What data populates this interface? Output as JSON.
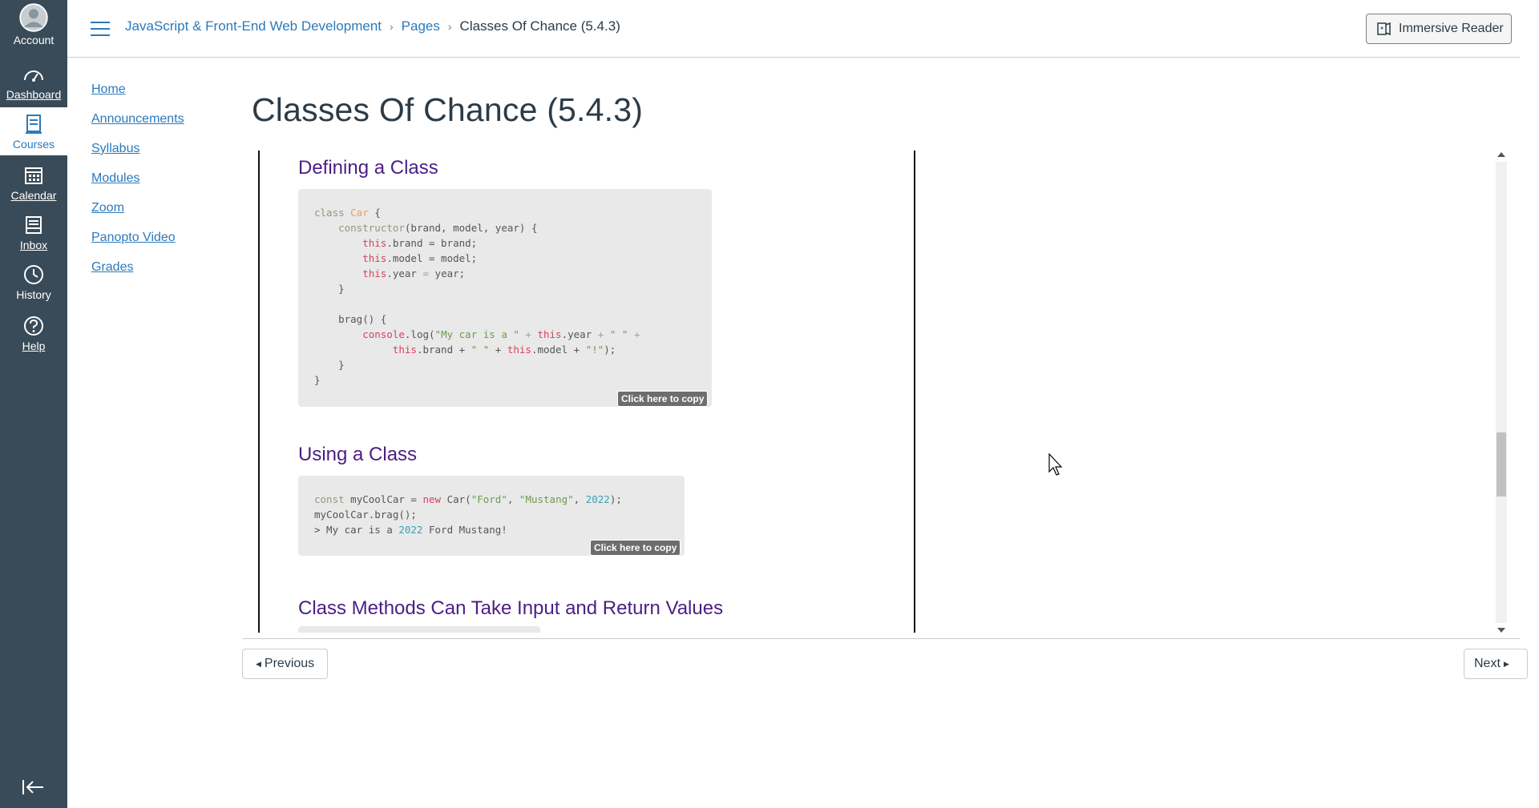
{
  "global_nav": {
    "account": "Account",
    "dashboard": "Dashboard",
    "courses": "Courses",
    "calendar": "Calendar",
    "inbox": "Inbox",
    "history": "History",
    "help": "Help"
  },
  "header": {
    "breadcrumb": [
      "JavaScript & Front-End Web Development",
      "Pages",
      "Classes Of Chance (5.4.3)"
    ],
    "immersive_reader": "Immersive Reader"
  },
  "course_nav": [
    "Home",
    "Announcements",
    "Syllabus",
    "Modules",
    "Zoom",
    "Panopto Video",
    "Grades"
  ],
  "page": {
    "title": "Classes Of Chance (5.4.3)",
    "sections": [
      {
        "heading": "Defining a Class"
      },
      {
        "heading": "Using a Class"
      },
      {
        "heading": "Class Methods Can Take Input and Return Values"
      }
    ],
    "copy_label": "Click here to copy",
    "code1": {
      "l1a": "class ",
      "l1b": "Car",
      "l1c": " {",
      "l2a": "    ",
      "l2b": "constructor",
      "l2c": "(brand, model, year) {",
      "l3a": "        ",
      "l3b": "this",
      "l3c": ".brand = brand;",
      "l4a": "        ",
      "l4b": "this",
      "l4c": ".model = model;",
      "l5a": "        ",
      "l5b": "this",
      "l5c": ".year ",
      "l5d": "=",
      "l5e": " year;",
      "l6": "    }",
      "l8": "    brag() {",
      "l9a": "        ",
      "l9b": "console",
      "l9c": ".log(",
      "l9d": "\"My car is a \"",
      "l9e": " + ",
      "l9f": "this",
      "l9g": ".year ",
      "l9h": "+",
      "l9i": " ",
      "l9j": "\" \"",
      "l9k": " +",
      "l10a": "             ",
      "l10b": "this",
      "l10c": ".brand + ",
      "l10d": "\" \"",
      "l10e": " + ",
      "l10f": "this",
      "l10g": ".model + ",
      "l10h": "\"!\"",
      "l10i": ");",
      "l11": "    }",
      "l12": "}"
    },
    "code2": {
      "l1a": "const",
      "l1b": " myCoolCar = ",
      "l1c": "new",
      "l1d": " Car(",
      "l1e": "\"Ford\"",
      "l1f": ", ",
      "l1g": "\"Mustang\"",
      "l1h": ", ",
      "l1i": "2022",
      "l1j": ");",
      "l2": "myCoolCar.brag();",
      "l3a": "> My car is a ",
      "l3b": "2022",
      "l3c": " Ford Mustang!"
    }
  },
  "footer": {
    "previous": "Previous",
    "next": "Next"
  }
}
